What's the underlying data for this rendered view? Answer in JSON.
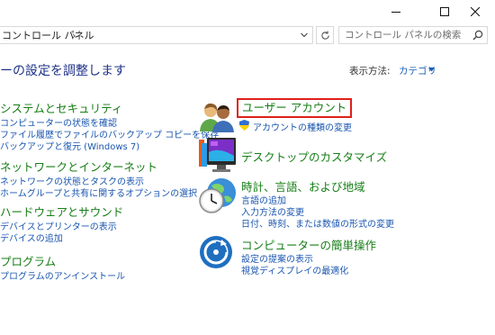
{
  "window": {
    "minimize_icon": "minimize-icon",
    "maximize_icon": "maximize-icon",
    "close_icon": "close-icon"
  },
  "address": {
    "breadcrumb": "コントロール パネル",
    "separator": "›",
    "dropdown_icon": "chevron-down-icon",
    "refresh_icon": "refresh-icon"
  },
  "search": {
    "placeholder": "コントロール パネルの検索",
    "icon": "search-icon"
  },
  "main": {
    "heading": "ーの設定を調整します",
    "view_by_label": "表示方法:",
    "view_by_value": "カテゴリ"
  },
  "left_categories": [
    {
      "title": "システムとセキュリティ",
      "links": [
        "コンピューターの状態を確認",
        "ファイル履歴でファイルのバックアップ コピーを保存",
        "バックアップと復元 (Windows 7)"
      ]
    },
    {
      "title": "ネットワークとインターネット",
      "links": [
        "ネットワークの状態とタスクの表示",
        "ホームグループと共有に関するオプションの選択"
      ]
    },
    {
      "title": "ハードウェアとサウンド",
      "links": [
        "デバイスとプリンターの表示",
        "デバイスの追加"
      ]
    },
    {
      "title": "プログラム",
      "links": [
        "プログラムのアンインストール"
      ]
    }
  ],
  "right_categories": [
    {
      "title": "ユーザー アカウント",
      "icon": "user-accounts-icon",
      "links": [
        "アカウントの種類の変更"
      ],
      "link_icon": "uac-shield-icon"
    },
    {
      "title": "デスクトップのカスタマイズ",
      "icon": "desktop-customization-icon",
      "links": []
    },
    {
      "title": "時計、言語、および地域",
      "icon": "clock-globe-icon",
      "links": [
        "言語の追加",
        "入力方法の変更",
        "日付、時刻、または数値の形式の変更"
      ]
    },
    {
      "title": "コンピューターの簡単操作",
      "icon": "ease-of-access-icon",
      "links": [
        "設定の提案の表示",
        "視覚ディスプレイの最適化"
      ]
    }
  ],
  "colors": {
    "category_title": "#167e16",
    "link": "#1a56b0",
    "heading": "#1e3287",
    "highlight_border": "#e0201a"
  }
}
